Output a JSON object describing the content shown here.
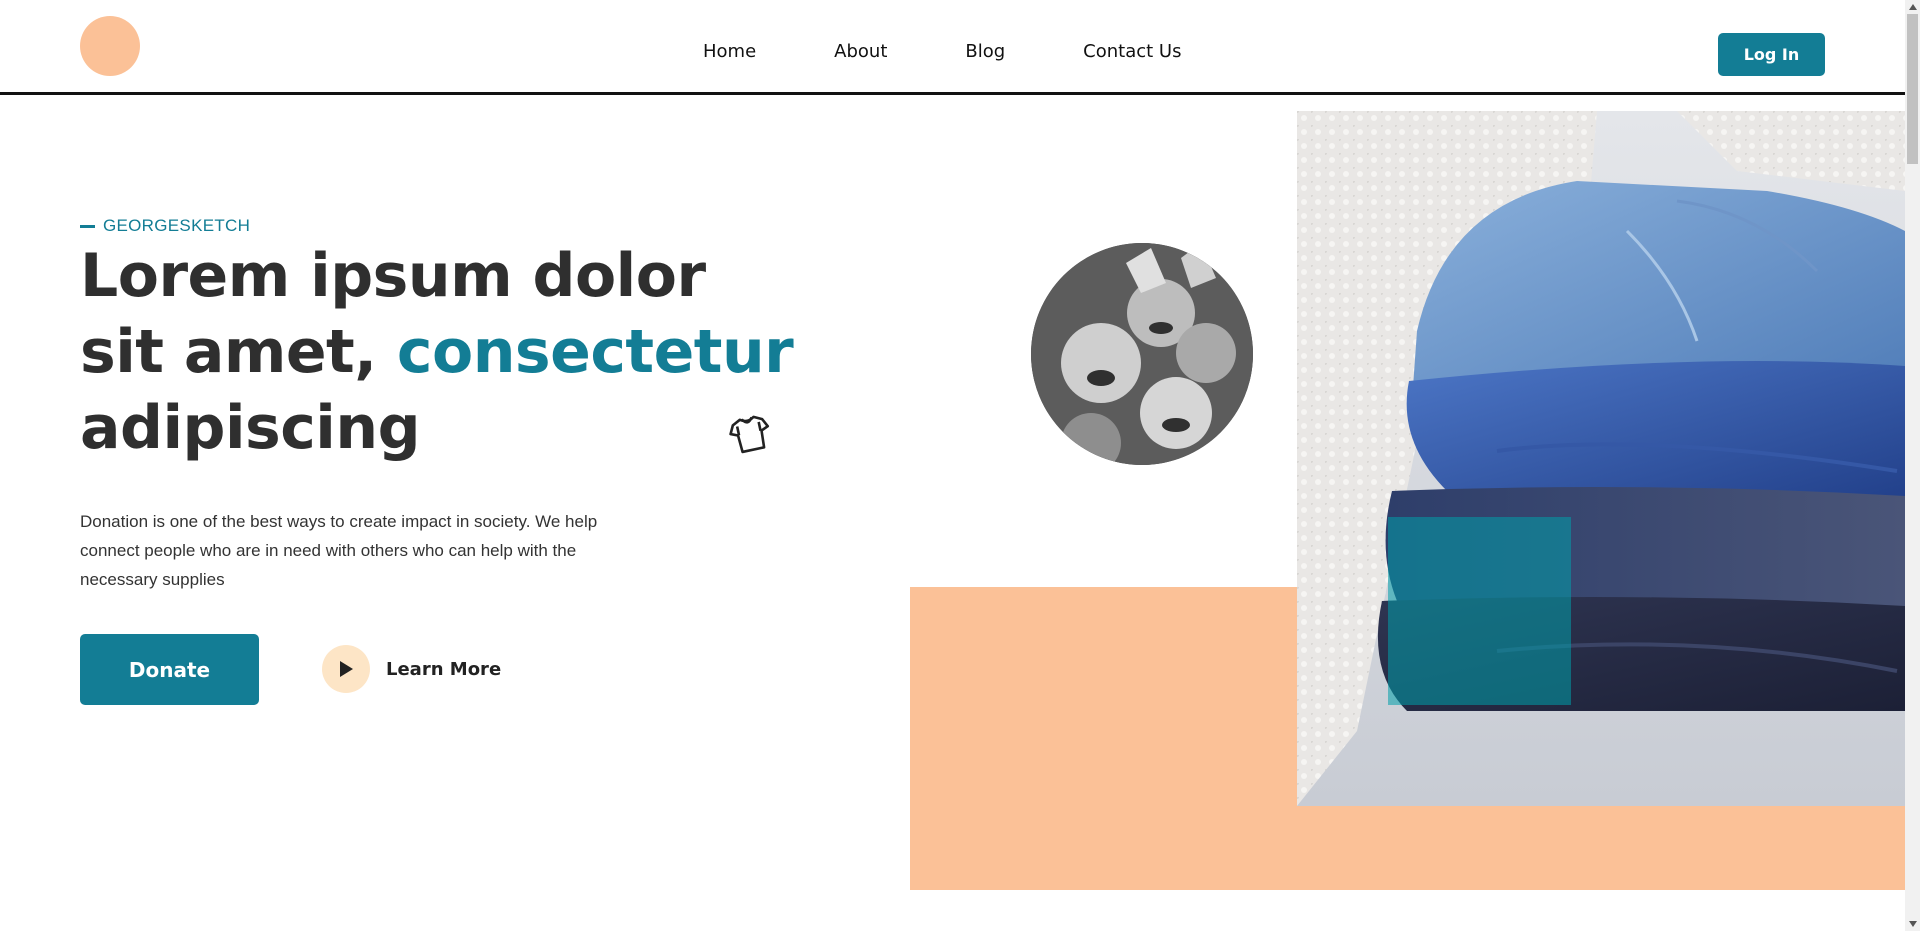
{
  "colors": {
    "brand_teal": "#137d95",
    "peach": "#fbc197",
    "highlight": "#fde5c6",
    "heading": "#2f2f2f"
  },
  "header": {
    "nav": [
      "Home",
      "About",
      "Blog",
      "Contact Us"
    ],
    "login_label": "Log In"
  },
  "hero": {
    "eyebrow": "GEORGESKETCH",
    "headline_part1": "Lorem ipsum dolor sit amet, ",
    "headline_accent": "consectetur",
    "headline_part2": " adipiscing",
    "description": "Donation is one of the best ways to create impact in society. We help connect people who are in need with others who can help with the necessary supplies",
    "donate_label": "Donate",
    "learn_more_label": "Learn More"
  },
  "icons": {
    "logo": "circle-logo-icon",
    "shirt": "tshirt-icon",
    "play": "play-icon"
  },
  "images": {
    "kids": "kids-photo",
    "jeans": "jeans-stack-photo"
  }
}
